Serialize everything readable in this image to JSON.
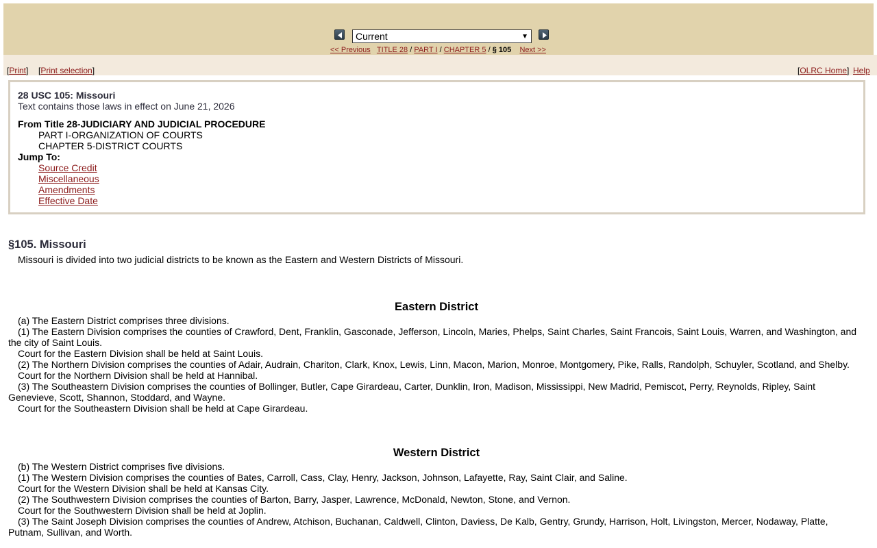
{
  "nav": {
    "release_selected": "Current",
    "prev_label": "<< Previous",
    "next_label": "Next >>",
    "crumb_title": "TITLE 28",
    "crumb_part": "PART I",
    "crumb_chapter": "CHAPTER 5",
    "crumb_current": "§ 105",
    "sep": "/"
  },
  "toolbar": {
    "print": "Print",
    "print_selection": "Print selection",
    "olrc_home": "OLRC Home",
    "help": "Help"
  },
  "info": {
    "title": "28 USC 105: Missouri",
    "effective": "Text contains those laws in effect on June 21, 2026",
    "from": "From Title 28-JUDICIARY AND JUDICIAL PROCEDURE",
    "part": "PART I-ORGANIZATION OF COURTS",
    "chapter": "CHAPTER 5-DISTRICT COURTS",
    "jump_label": "Jump To:",
    "jump_links": [
      "Source Credit",
      "Miscellaneous",
      "Amendments",
      "Effective Date"
    ]
  },
  "section": {
    "heading": "§105. Missouri",
    "intro": "Missouri is divided into two judicial districts to be known as the Eastern and Western Districts of Missouri.",
    "eastern": {
      "heading": "Eastern District",
      "paras": [
        "(a) The Eastern District comprises three divisions.",
        "(1) The Eastern Division comprises the counties of Crawford, Dent, Franklin, Gasconade, Jefferson, Lincoln, Maries, Phelps, Saint Charles, Saint Francois, Saint Louis, Warren, and Washington, and the city of Saint Louis.",
        "Court for the Eastern Division shall be held at Saint Louis.",
        "(2) The Northern Division comprises the counties of Adair, Audrain, Chariton, Clark, Knox, Lewis, Linn, Macon, Marion, Monroe, Montgomery, Pike, Ralls, Randolph, Schuyler, Scotland, and Shelby.",
        "Court for the Northern Division shall be held at Hannibal.",
        "(3) The Southeastern Division comprises the counties of Bollinger, Butler, Cape Girardeau, Carter, Dunklin, Iron, Madison, Mississippi, New Madrid, Pemiscot, Perry, Reynolds, Ripley, Saint Genevieve, Scott, Shannon, Stoddard, and Wayne.",
        "Court for the Southeastern Division shall be held at Cape Girardeau."
      ]
    },
    "western": {
      "heading": "Western District",
      "paras": [
        "(b) The Western District comprises five divisions.",
        "(1) The Western Division comprises the counties of Bates, Carroll, Cass, Clay, Henry, Jackson, Johnson, Lafayette, Ray, Saint Clair, and Saline.",
        "Court for the Western Division shall be held at Kansas City.",
        "(2) The Southwestern Division comprises the counties of Barton, Barry, Jasper, Lawrence, McDonald, Newton, Stone, and Vernon.",
        "Court for the Southwestern Division shall be held at Joplin.",
        "(3) The Saint Joseph Division comprises the counties of Andrew, Atchison, Buchanan, Caldwell, Clinton, Daviess, De Kalb, Gentry, Grundy, Harrison, Holt, Livingston, Mercer, Nodaway, Platte, Putnam, Sullivan, and Worth."
      ]
    }
  }
}
